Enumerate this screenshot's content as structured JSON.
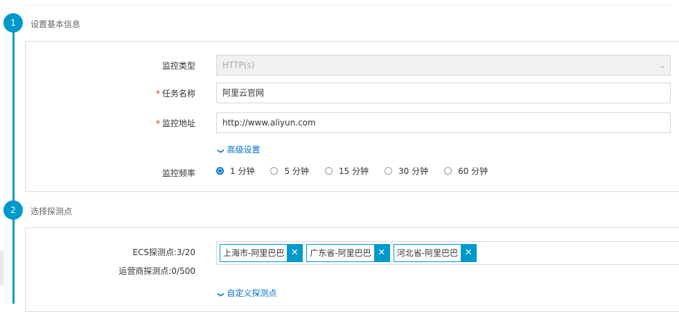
{
  "steps": [
    {
      "number": "1",
      "title": "设置基本信息"
    },
    {
      "number": "2",
      "title": "选择探测点"
    }
  ],
  "form": {
    "monitor_type_label": "监控类型",
    "monitor_type_value": "HTTP(s)",
    "task_name_label": "任务名称",
    "task_name_value": "阿里云官网",
    "monitor_url_label": "监控地址",
    "monitor_url_value": "http://www.aliyun.com",
    "required_mark": "*",
    "advanced_link": "高级设置",
    "frequency_label": "监控频率",
    "frequency_options": [
      "1 分钟",
      "5 分钟",
      "15 分钟",
      "30 分钟",
      "60 分钟"
    ],
    "frequency_selected": "1 分钟"
  },
  "probes": {
    "ecs_label": "ECS探测点:3/20",
    "isp_label": "运营商探测点:0/500",
    "tags": [
      "上海市-阿里巴巴",
      "广东省-阿里巴巴",
      "河北省-阿里巴巴"
    ],
    "custom_link": "自定义探测点"
  },
  "icons": {
    "chevron": "chevron-down-icon",
    "select_arrow": "select-arrow-icon",
    "remove": "close-icon"
  },
  "colors": {
    "accent": "#0099cc",
    "link": "#0070cc",
    "required": "#e0301e"
  }
}
